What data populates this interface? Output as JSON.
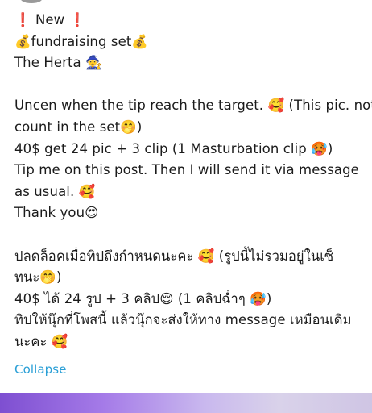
{
  "post": {
    "lines": [
      "❗ New ❗",
      "💰fundraising set💰",
      "The Herta 🧙",
      "",
      "Uncen when the tip reach the target. 🥰 (This pic. not",
      "count in the set🤭)",
      "40$ get 24 pic + 3 clip (1 Masturbation clip 🥵)",
      "Tip me on this post. Then I will send it via message",
      "as usual. 🥰",
      "Thank you😍",
      "",
      "ปลดล็อคเมื่อทิปถึงกำหนดนะคะ 🥰 (รูปนี้ไม่รวมอยู่ในเซ็",
      "ทนะ🤭)",
      "40$ ได้ 24 รูป + 3 คลิป😌 (1 คลิปฉ่ำๆ 🥵)",
      "ทิปให้นุ๊กที่โพสนี้ แล้วนุ๊กจะส่งให้ทาง message เหมือนเดิม",
      "นะคะ 🥰"
    ],
    "collapse_label": "Collapse"
  },
  "colors": {
    "link": "#2a9fd6",
    "text": "#1b1b1b",
    "media_gradient": [
      "#7e4fd1",
      "#a57be8",
      "#c9b8ee",
      "#d9d2ea"
    ]
  }
}
